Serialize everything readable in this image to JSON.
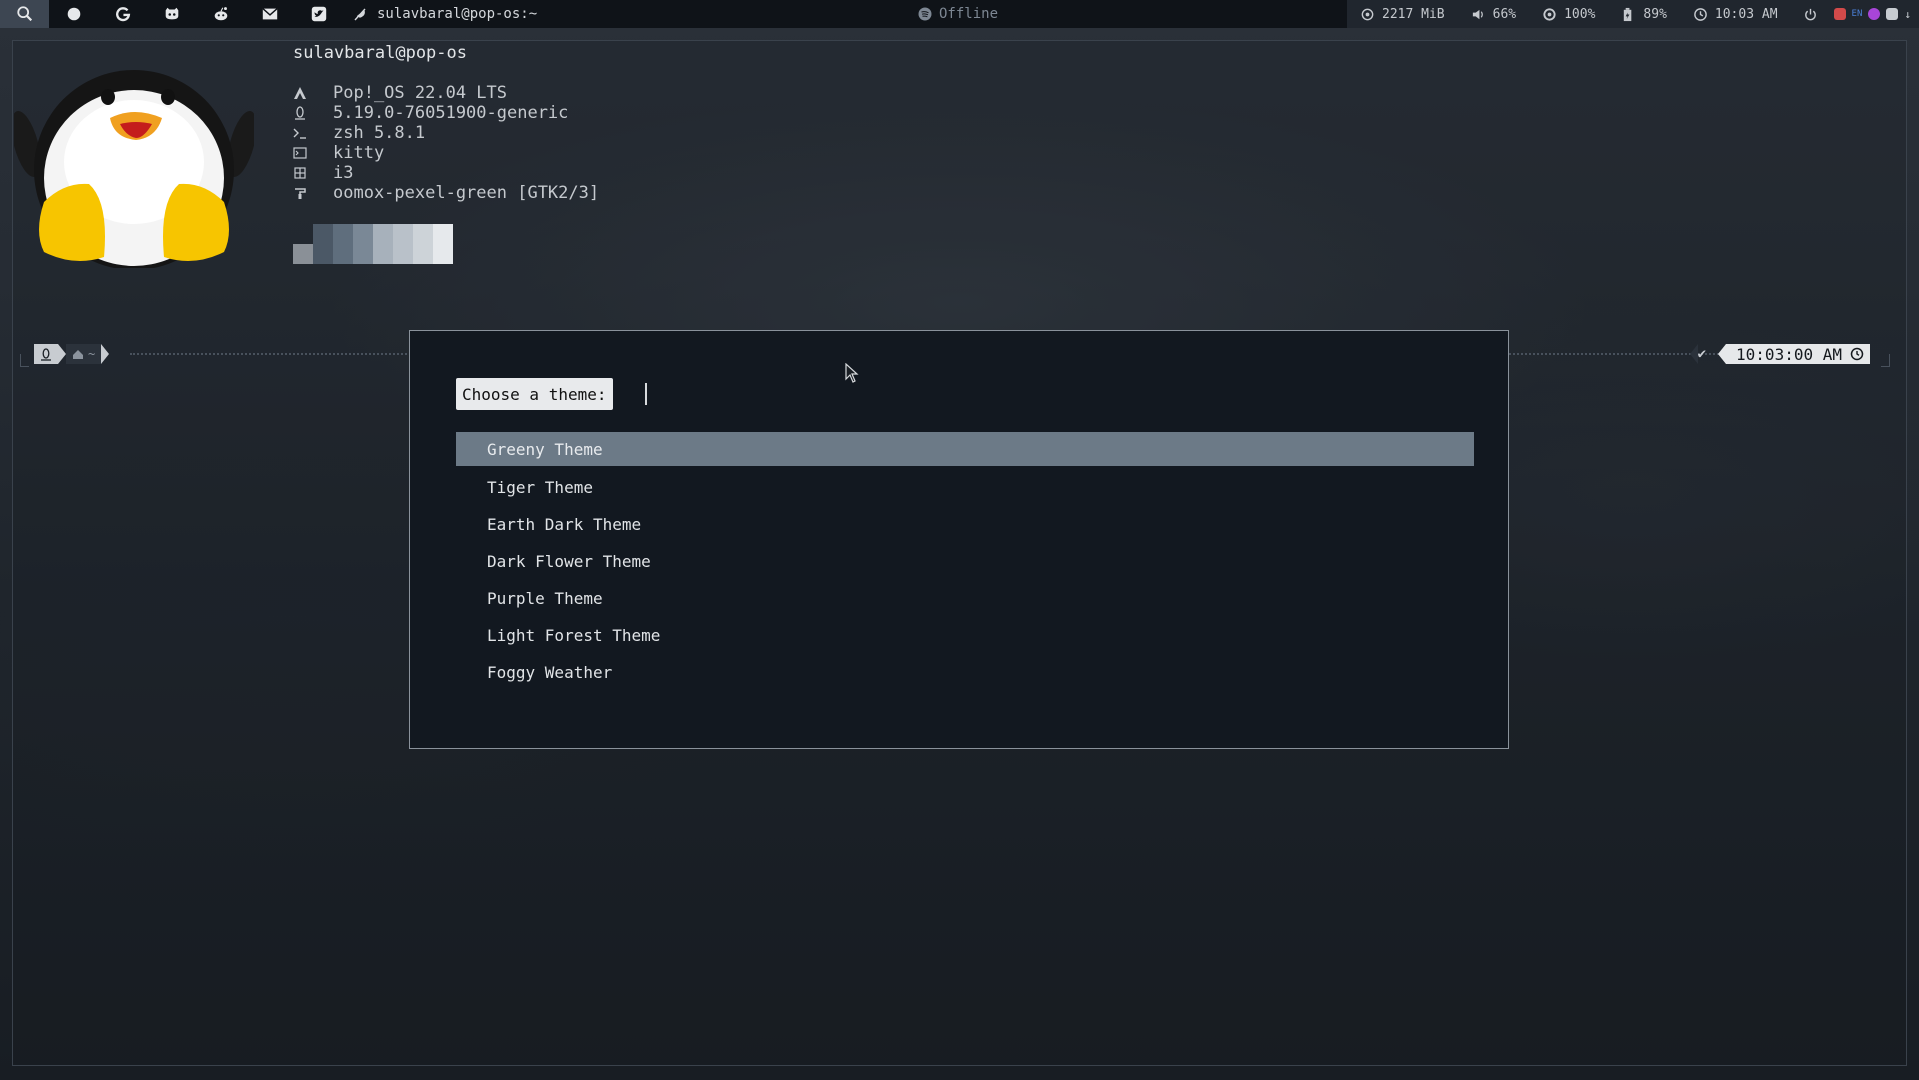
{
  "topbar": {
    "icons": [
      "search-icon",
      "circle-icon",
      "google-icon",
      "github-icon",
      "reddit-icon",
      "mail-icon",
      "twitter-icon"
    ],
    "window_title": "sulavbaral@pop-os:~",
    "media_status": "Offline",
    "memory": "2217 MiB",
    "volume": "66%",
    "brightness": "100%",
    "battery": "89%",
    "clock": "10:03 AM",
    "tray_label": "EN"
  },
  "neofetch": {
    "user_host": "sulavbaral@pop-os",
    "os": "Pop!_OS 22.04 LTS",
    "kernel": "5.19.0-76051900-generic",
    "shell": "zsh 5.8.1",
    "terminal": "kitty",
    "wm": "i3",
    "theme": "oomox-pexel-green [GTK2/3]",
    "palette": [
      "#8a9097",
      "#4b5866",
      "#5f6e7d",
      "#7a8896",
      "#a7b1bb",
      "#b9c1c9",
      "#cdd3d8",
      "#e6e9ec"
    ]
  },
  "prompt": {
    "dir_symbol": "~",
    "status_symbol": "✔",
    "time": "10:03:00 AM"
  },
  "dialog": {
    "prompt_label": "Choose a theme:",
    "input_value": "",
    "items": [
      {
        "label": "Greeny Theme",
        "selected": true
      },
      {
        "label": "Tiger Theme",
        "selected": false
      },
      {
        "label": "Earth Dark Theme",
        "selected": false
      },
      {
        "label": "Dark Flower Theme",
        "selected": false
      },
      {
        "label": "Purple Theme",
        "selected": false
      },
      {
        "label": "Light Forest Theme",
        "selected": false
      },
      {
        "label": "Foggy Weather",
        "selected": false
      }
    ]
  },
  "colors": {
    "selection": "#6c7a87",
    "topbar_bg": "#0f1318",
    "dialog_bg": "#121820"
  }
}
